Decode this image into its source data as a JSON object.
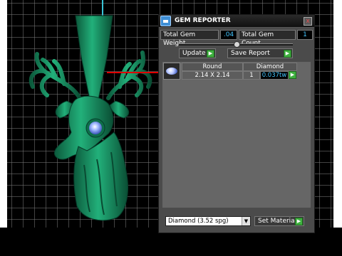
{
  "panel": {
    "title": "GEM REPORTER",
    "close_glyph": "x",
    "total_weight_label": "Total Gem Weight",
    "total_weight_value": ".04",
    "total_count_label": "Total Gem Count",
    "total_count_value": "1",
    "update_label": "Update",
    "save_report_label": "Save Report",
    "go_glyph": "▶",
    "slider_level": 0.55,
    "gems": [
      {
        "shape": "Round",
        "size": "2.14 X 2.14",
        "material": "Diamond",
        "count": "1",
        "weight": "0.037tw"
      }
    ],
    "material_select_value": "Diamond    (3.52 spg)",
    "dropdown_glyph": "▼",
    "set_material_label": "Set Material"
  },
  "colors": {
    "model_green": "#1a9a6a",
    "axis_red": "#e00000",
    "axis_cyan": "#39c4d6",
    "value_text": "#44c6ff",
    "go_button": "#3fb03f"
  },
  "icons": [
    "gem-reporter-app-icon",
    "close-icon",
    "play-arrow-icon",
    "round-diamond-icon",
    "dropdown-arrow-icon"
  ]
}
